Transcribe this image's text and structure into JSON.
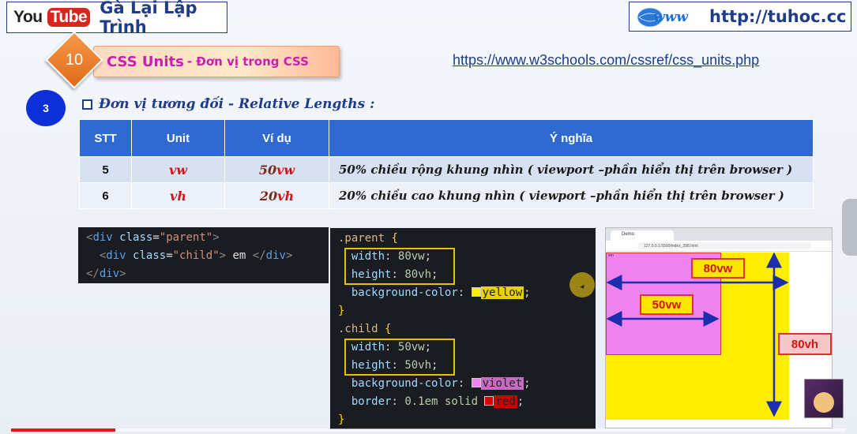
{
  "header": {
    "yt_you": "You",
    "yt_tube": "Tube",
    "channel_name": "Gà Lại Lập Trình",
    "www_logo_text": "www",
    "website": "http://tuhoc.cc"
  },
  "lesson": {
    "number": "10",
    "title": "CSS Units",
    "subtitle": "- Đơn vị trong CSS",
    "reference_url": "https://www.w3schools.com/cssref/css_units.php"
  },
  "section": {
    "number": "3",
    "heading": "Đơn vị tương đối - Relative Lengths :"
  },
  "table": {
    "headers": [
      "STT",
      "Unit",
      "Ví dụ",
      "Ý nghĩa"
    ],
    "rows": [
      {
        "stt": "5",
        "unit": "vw",
        "example_num": "50",
        "example_unit": "vw",
        "meaning": "50% chiều rộng khung nhìn ( viewport –phần hiển thị trên browser )"
      },
      {
        "stt": "6",
        "unit": "vh",
        "example_num": "20",
        "example_unit": "vh",
        "meaning": "20% chiều cao khung nhìn ( viewport –phần hiển thị trên browser )"
      }
    ]
  },
  "html_code": {
    "l1_tag_open": "<",
    "l1_name": "div",
    "l1_attr": "class",
    "l1_eq": "=",
    "l1_val": "\"parent\"",
    "l1_close": ">",
    "l2_tag_open": "<",
    "l2_name": "div",
    "l2_attr": "class",
    "l2_eq": "=",
    "l2_val": "\"child\"",
    "l2_close": ">",
    "l2_text": " em ",
    "l2_end_open": "</",
    "l2_end_name": "div",
    "l2_end_close": ">",
    "l3_end_open": "</",
    "l3_end_name": "div",
    "l3_end_close": ">"
  },
  "css_code": {
    "parent_selector": ".parent",
    "child_selector": ".child",
    "open_brace": "{",
    "close_brace": "}",
    "width_prop": "width",
    "height_prop": "height",
    "bg_prop": "background-color",
    "border_prop": "border",
    "parent_width": "80vw",
    "parent_height": "80vh",
    "parent_bg": "yellow",
    "child_width": "50vw",
    "child_height": "50vh",
    "child_bg": "violet",
    "child_border_pre": "0.1em solid ",
    "child_border_color": "red",
    "colon": ":",
    "semicolon": ";"
  },
  "demo": {
    "tab_title": "Demo",
    "address": "127.0.0.1:5500/index_398.html",
    "child_text": "em",
    "label_80vw": "80vw",
    "label_50vw": "50vw",
    "label_80vh": "80vh"
  },
  "colors": {
    "accent": "#1f3c88",
    "table_header": "#2f6ad1",
    "unit_red": "#d51313",
    "lesson_magenta": "#c81fb0",
    "arrow_blue": "#1c2dae"
  },
  "player": {
    "progress": 0.125
  }
}
